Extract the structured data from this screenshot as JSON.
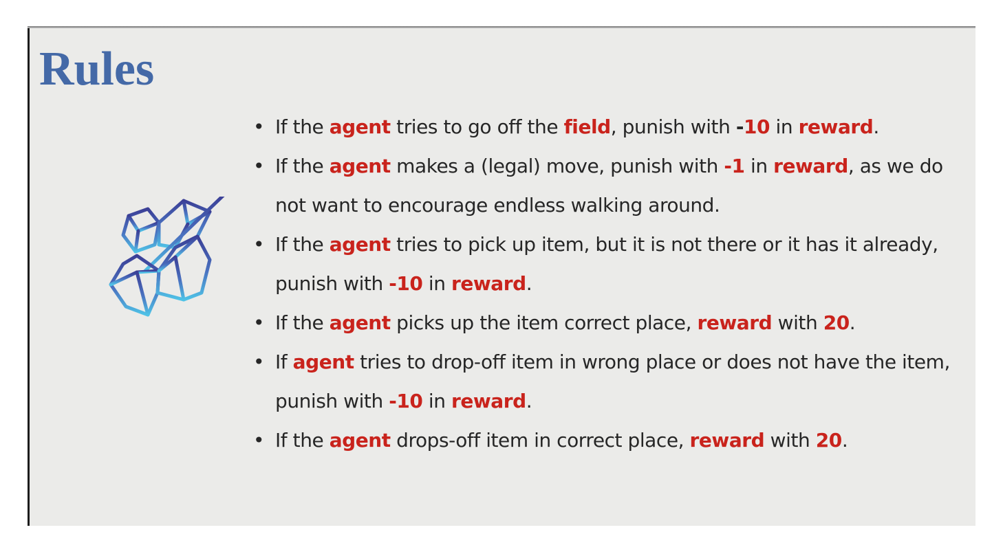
{
  "slide": {
    "title": "Rules",
    "logo_icon": "isometric-cubes-icon",
    "colors": {
      "title": "#4469a7",
      "highlight": "#c9231c",
      "text": "#262626",
      "background": "#ebebe9"
    },
    "bullet_glyph": "•",
    "rules": [
      {
        "runs": [
          {
            "t": "If the "
          },
          {
            "t": "agent",
            "hl": true
          },
          {
            "t": " tries to go off the "
          },
          {
            "t": "field",
            "hl": true
          },
          {
            "t": ", punish with "
          },
          {
            "t": "-",
            "bold": true
          },
          {
            "t": "10",
            "hl": true
          },
          {
            "t": " in "
          },
          {
            "t": "reward",
            "hl": true
          },
          {
            "t": "."
          }
        ]
      },
      {
        "runs": [
          {
            "t": "If the "
          },
          {
            "t": "agent",
            "hl": true
          },
          {
            "t": " makes a (legal) move, punish with "
          },
          {
            "t": "-1",
            "hl": true
          },
          {
            "t": " in "
          },
          {
            "t": "reward",
            "hl": true
          },
          {
            "t": ", as we do not want to encourage endless walking around."
          }
        ]
      },
      {
        "runs": [
          {
            "t": "If the "
          },
          {
            "t": "agent",
            "hl": true
          },
          {
            "t": " tries to pick up item, but it is not there or it has it already, punish with "
          },
          {
            "t": "-10",
            "hl": true
          },
          {
            "t": " in "
          },
          {
            "t": "reward",
            "hl": true
          },
          {
            "t": "."
          }
        ]
      },
      {
        "runs": [
          {
            "t": "If the "
          },
          {
            "t": "agent",
            "hl": true
          },
          {
            "t": " picks up the item correct place, "
          },
          {
            "t": "reward",
            "hl": true
          },
          {
            "t": " with "
          },
          {
            "t": "20",
            "hl": true
          },
          {
            "t": "."
          }
        ]
      },
      {
        "runs": [
          {
            "t": "If "
          },
          {
            "t": "agent",
            "hl": true
          },
          {
            "t": " tries to drop-off item in wrong place or does not have the item, punish with "
          },
          {
            "t": "-10",
            "hl": true
          },
          {
            "t": " in "
          },
          {
            "t": "reward",
            "hl": true
          },
          {
            "t": "."
          }
        ]
      },
      {
        "runs": [
          {
            "t": "If the "
          },
          {
            "t": "agent",
            "hl": true
          },
          {
            "t": " drops-off item in correct place, "
          },
          {
            "t": "reward",
            "hl": true
          },
          {
            "t": " with "
          },
          {
            "t": "20",
            "hl": true
          },
          {
            "t": "."
          }
        ]
      }
    ]
  }
}
